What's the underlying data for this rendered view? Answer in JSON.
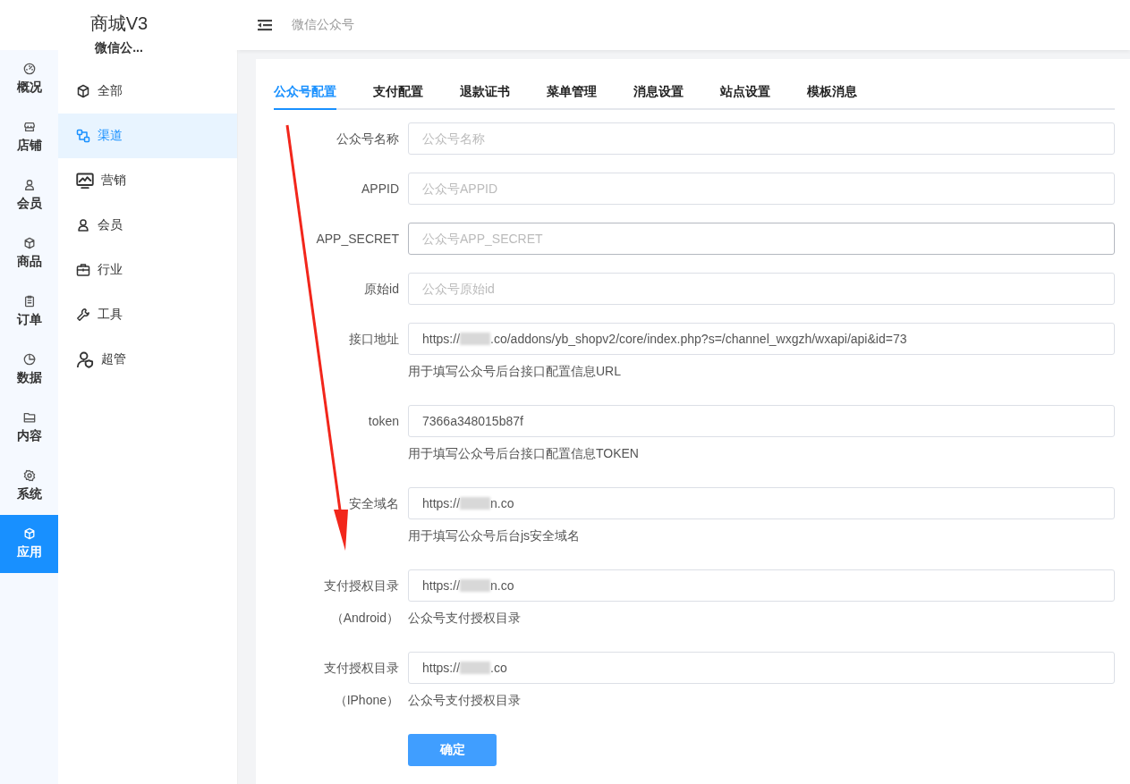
{
  "brand": {
    "title": "商城V3",
    "subtitle": "微信公..."
  },
  "rail": [
    {
      "label": "概况",
      "kind": "gauge",
      "selected": false
    },
    {
      "label": "店铺",
      "kind": "shop",
      "selected": false
    },
    {
      "label": "会员",
      "kind": "user",
      "selected": false
    },
    {
      "label": "商品",
      "kind": "cube",
      "selected": false
    },
    {
      "label": "订单",
      "kind": "clipboard",
      "selected": false
    },
    {
      "label": "数据",
      "kind": "pie",
      "selected": false
    },
    {
      "label": "内容",
      "kind": "folder",
      "selected": false
    },
    {
      "label": "系统",
      "kind": "gear",
      "selected": false
    },
    {
      "label": "应用",
      "kind": "cube",
      "selected": true
    }
  ],
  "submenu": [
    {
      "label": "全部",
      "kind": "cube",
      "selected": false
    },
    {
      "label": "渠道",
      "kind": "channel",
      "selected": true
    },
    {
      "label": "营销",
      "kind": "chart",
      "selected": false
    },
    {
      "label": "会员",
      "kind": "user",
      "selected": false
    },
    {
      "label": "行业",
      "kind": "briefcase",
      "selected": false
    },
    {
      "label": "工具",
      "kind": "wrench",
      "selected": false
    },
    {
      "label": "超管",
      "kind": "admin",
      "selected": false
    }
  ],
  "header": {
    "breadcrumb": "微信公众号"
  },
  "tabs": [
    {
      "label": "公众号配置",
      "selected": true
    },
    {
      "label": "支付配置",
      "selected": false
    },
    {
      "label": "退款证书",
      "selected": false
    },
    {
      "label": "菜单管理",
      "selected": false
    },
    {
      "label": "消息设置",
      "selected": false
    },
    {
      "label": "站点设置",
      "selected": false
    },
    {
      "label": "模板消息",
      "selected": false
    }
  ],
  "form": {
    "fields": [
      {
        "label": "公众号名称",
        "placeholder": "公众号名称",
        "focused": false
      },
      {
        "label": "APPID",
        "placeholder": "公众号APPID",
        "focused": false
      },
      {
        "label": "APP_SECRET",
        "placeholder": "公众号APP_SECRET",
        "focused": true
      },
      {
        "label": "原始id",
        "placeholder": "公众号原始id",
        "focused": false
      },
      {
        "label": "接口地址",
        "value_prefix": "https://",
        "redacted": true,
        "value_suffix": ".co/addons/yb_shopv2/core/index.php?s=/channel_wxgzh/wxapi/api&id=73",
        "help": "用于填写公众号后台接口配置信息URL",
        "focused": false
      },
      {
        "label": "token",
        "value_prefix": "7366a348015b87f",
        "help": "用于填写公众号后台接口配置信息TOKEN",
        "focused": false
      },
      {
        "label": "安全域名",
        "value_prefix": "https://",
        "redacted": true,
        "value_suffix": "n.co",
        "help": "用于填写公众号后台js安全域名",
        "focused": false
      },
      {
        "label": "支付授权目录",
        "sublabel": "（Android）",
        "value_prefix": "https://",
        "redacted": true,
        "value_suffix": "n.co",
        "help": "公众号支付授权目录",
        "focused": false
      },
      {
        "label": "支付授权目录",
        "sublabel": "（IPhone）",
        "value_prefix": "https://",
        "redacted": true,
        "value_suffix": ".co",
        "help": "公众号支付授权目录",
        "focused": false
      }
    ],
    "submit": "确定"
  },
  "annotation": {
    "kind": "arrow"
  }
}
